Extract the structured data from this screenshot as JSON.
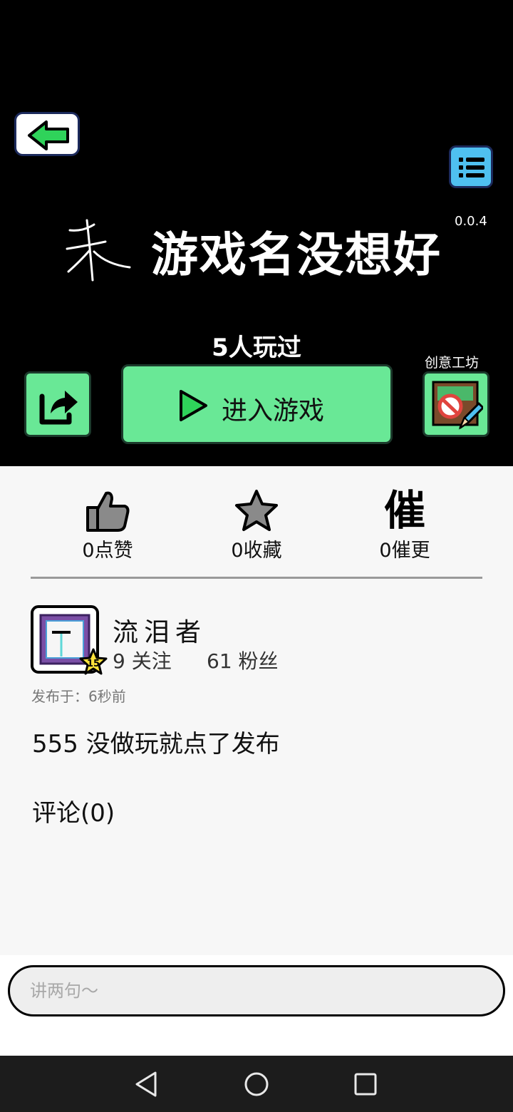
{
  "game": {
    "title": "游戏名没想好",
    "version": "0.0.4",
    "play_count": "5人玩过",
    "play_button": "进入游戏",
    "workshop_label": "创意工坊"
  },
  "stats": {
    "likes": "0点赞",
    "favorites": "0收藏",
    "urge_glyph": "催",
    "urges": "0催更"
  },
  "author": {
    "name": "流泪者",
    "level": "15",
    "following": "9 关注",
    "fans": "61 粉丝"
  },
  "post": {
    "published": "发布于：6秒前",
    "description": "555 没做玩就点了发布"
  },
  "comments": {
    "title": "评论(0)",
    "input_placeholder": "讲两句～"
  },
  "icons": {
    "back": "arrow-left-icon",
    "menu": "list-icon",
    "share": "share-icon",
    "play": "play-icon",
    "workshop": "workshop-edit-icon",
    "like": "thumbs-up-icon",
    "favorite": "star-icon",
    "nav_back": "triangle-back-icon",
    "nav_home": "circle-home-icon",
    "nav_recent": "square-recent-icon"
  },
  "colors": {
    "accent_green": "#69e896",
    "menu_blue": "#4fc0f0",
    "header_bg": "#000000"
  }
}
